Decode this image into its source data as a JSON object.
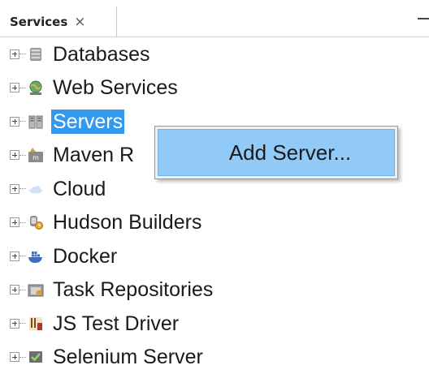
{
  "tab": {
    "title": "Services",
    "close_glyph": "×"
  },
  "tree": {
    "items": [
      {
        "label": "Databases",
        "icon": "database-icon"
      },
      {
        "label": "Web Services",
        "icon": "globe-icon"
      },
      {
        "label": "Servers",
        "icon": "server-icon",
        "selected": true
      },
      {
        "label": "Maven R",
        "icon": "maven-icon"
      },
      {
        "label": "Cloud",
        "icon": "cloud-icon"
      },
      {
        "label": "Hudson Builders",
        "icon": "hudson-icon"
      },
      {
        "label": "Docker",
        "icon": "docker-icon"
      },
      {
        "label": "Task Repositories",
        "icon": "task-repository-icon"
      },
      {
        "label": "JS Test Driver",
        "icon": "js-test-driver-icon"
      },
      {
        "label": "Selenium Server",
        "icon": "selenium-icon"
      }
    ]
  },
  "context_menu": {
    "items": [
      {
        "label": "Add Server..."
      }
    ]
  },
  "colors": {
    "selection": "#3399ee",
    "menu_highlight": "#91c9f7"
  }
}
